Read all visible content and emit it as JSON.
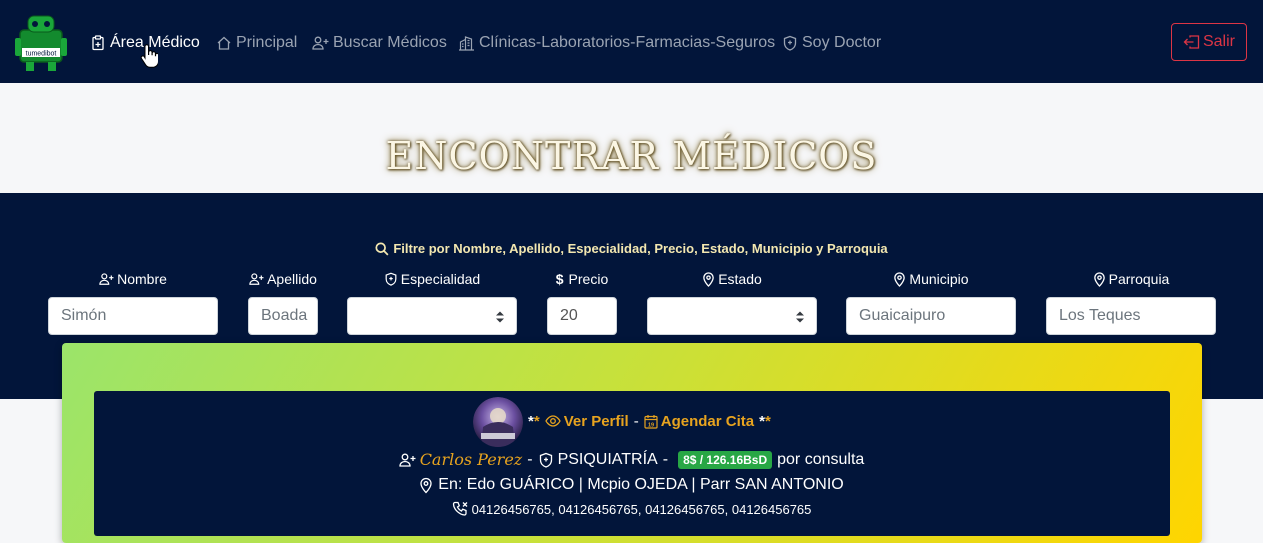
{
  "nav": {
    "items": [
      {
        "label": "Área Médico",
        "icon": "clipboard-plus-icon"
      },
      {
        "label": "Principal",
        "icon": "house-icon"
      },
      {
        "label": "Buscar Médicos",
        "icon": "person-plus-icon"
      },
      {
        "label": "Clínicas-Laboratorios-Farmacias-Seguros",
        "icon": "buildings-icon"
      },
      {
        "label": "Soy Doctor",
        "icon": "shield-icon"
      }
    ],
    "logout_label": "Salir",
    "logo_text": "tumedibot"
  },
  "page": {
    "title": "ENCONTRAR MÉDICOS"
  },
  "filters": {
    "heading": "Filtre por Nombre, Apellido, Especialidad, Precio, Estado, Municipio y Parroquia",
    "fields": [
      {
        "label": "Nombre",
        "placeholder": "Simón",
        "value": ""
      },
      {
        "label": "Apellido",
        "placeholder": "Boada",
        "value": ""
      },
      {
        "label": "Especialidad",
        "value": ""
      },
      {
        "label": "Precio",
        "placeholder": "",
        "value": "20"
      },
      {
        "label": "Estado",
        "value": ""
      },
      {
        "label": "Municipio",
        "placeholder": "Guaicaipuro",
        "value": ""
      },
      {
        "label": "Parroquia",
        "placeholder": "Los Teques",
        "value": ""
      }
    ]
  },
  "result": {
    "stars_left": "**",
    "ver_perfil": "Ver Perfil",
    "dash": "-",
    "agendar": "Agendar Cita",
    "stars_right": "**",
    "doctor_name": "Carlos Perez",
    "specialty": "PSIQUIATRÍA",
    "price": "8$ / 126.16BsD",
    "per_consult": "por consulta",
    "location": "En: Edo GUÁRICO | Mcpio OJEDA | Parr SAN ANTONIO",
    "phones": "04126456765, 04126456765, 04126456765, 04126456765"
  },
  "colors": {
    "navy": "#02153a",
    "gold": "#e7a31f",
    "danger": "#dc3545",
    "success": "#28a745"
  }
}
